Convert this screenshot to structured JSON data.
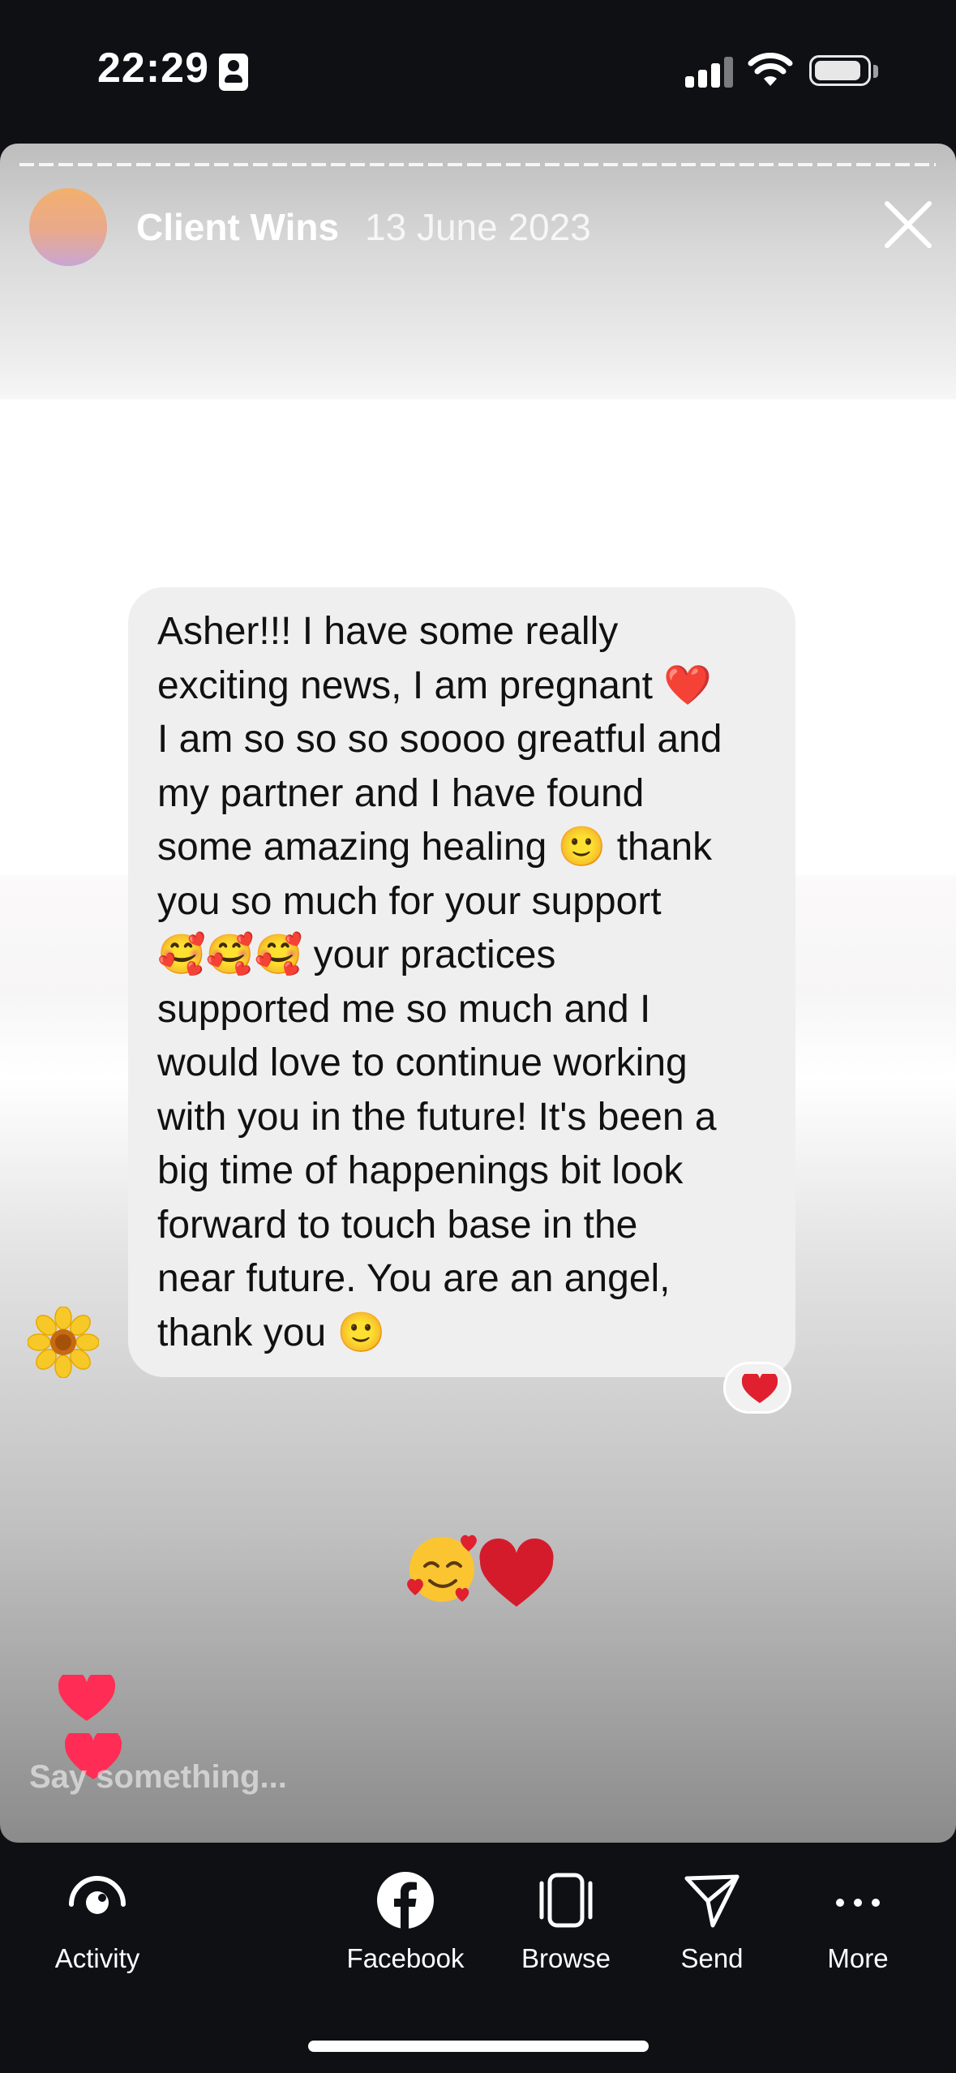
{
  "status_bar": {
    "time": "22:29"
  },
  "story": {
    "account_name": "Client Wins",
    "date": "13 June 2023"
  },
  "message": {
    "text": "Asher!!! I have some really\nexciting news, I am pregnant ❤️\nI am so so so soooo greatful and\nmy partner and I have found\nsome amazing healing 🙂 thank\nyou so much for your support\n🥰🥰🥰 your practices\nsupported me so much and I\nwould love to continue working\nwith you in the future! It's been a\nbig time of happenings bit look\nforward to touch base in the\nnear future. You are an angel,\nthank you 🙂",
    "sender_avatar_emoji": "🌼",
    "reaction": "heart"
  },
  "story_emoji": "🥰❤️",
  "reply": {
    "placeholder": "Say something..."
  },
  "toolbar": [
    {
      "label": "Activity",
      "icon": "activity-eye-icon"
    },
    {
      "label": "Facebook",
      "icon": "facebook-icon"
    },
    {
      "label": "Browse",
      "icon": "browse-icon"
    },
    {
      "label": "Send",
      "icon": "send-icon"
    },
    {
      "label": "More",
      "icon": "more-icon"
    }
  ],
  "colors": {
    "background": "#0e1014",
    "heart": "#ff2d55",
    "bubble": "#efefef"
  }
}
